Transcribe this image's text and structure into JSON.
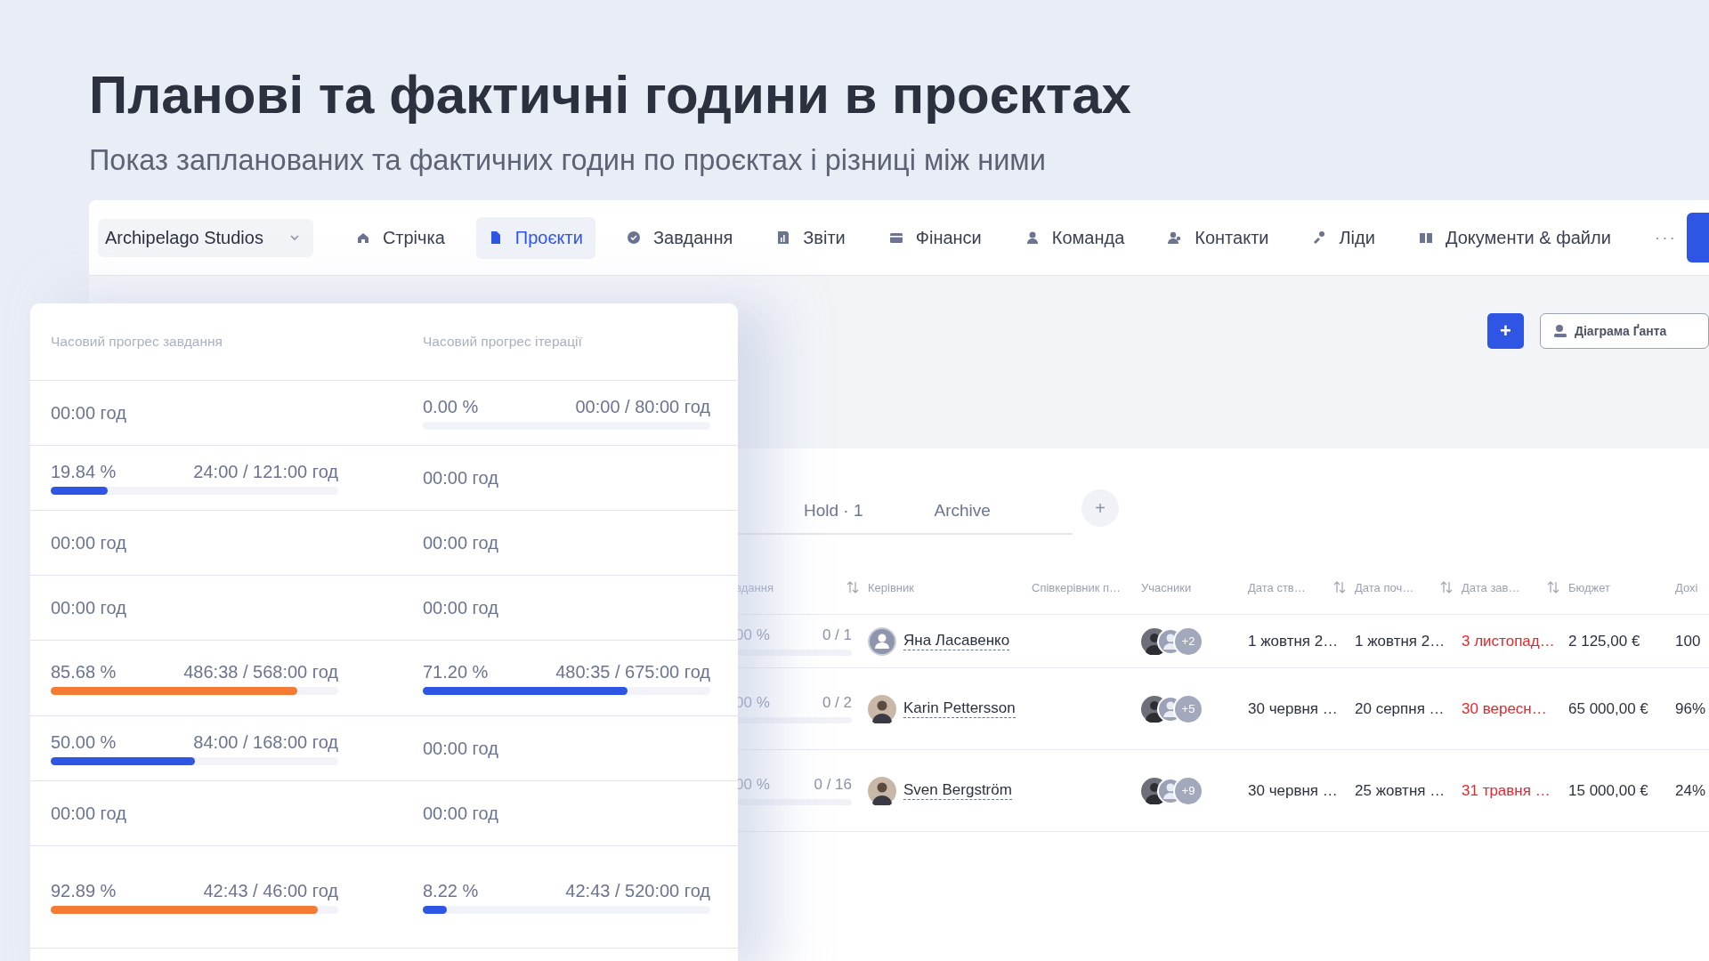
{
  "heading": {
    "title": "Планові та фактичні години в проєктах",
    "subtitle": "Показ запланованих та фактичних годин по проєктах і різниці між ними"
  },
  "workspace": {
    "label": "Archipelago Studios"
  },
  "nav": [
    {
      "label": "Стрічка",
      "selected": false
    },
    {
      "label": "Проєкти",
      "selected": true
    },
    {
      "label": "Завдання",
      "selected": false
    },
    {
      "label": "Звіти",
      "selected": false
    },
    {
      "label": "Фінанси",
      "selected": false
    },
    {
      "label": "Команда",
      "selected": false
    },
    {
      "label": "Контакти",
      "selected": false
    },
    {
      "label": "Ліди",
      "selected": false
    },
    {
      "label": "Документи & файли",
      "selected": false
    }
  ],
  "nav_more": "···",
  "toolbar": {
    "add": "+",
    "gantt": "Діаграма Ґанта"
  },
  "status_tabs": [
    {
      "label": "Hold · 1",
      "selected": false
    },
    {
      "label": "Archive",
      "selected": false
    }
  ],
  "add_tab": "+",
  "table": {
    "columns": [
      {
        "label": "вдання",
        "sortable": true
      },
      {
        "label": "Керівник",
        "sortable": false
      },
      {
        "label": "Співкерівник п…",
        "sortable": false
      },
      {
        "label": "Учасники",
        "sortable": false
      },
      {
        "label": "Дата ств…",
        "sortable": true
      },
      {
        "label": "Дата поч…",
        "sortable": true
      },
      {
        "label": "Дата зав…",
        "sortable": true
      },
      {
        "label": "Бюджет",
        "sortable": false
      },
      {
        "label": "Дохі",
        "sortable": false
      }
    ],
    "rows": [
      {
        "progress": {
          "percent": "00 %",
          "count": "0 / 1"
        },
        "manager": {
          "name": "Яна Ласавенко",
          "kind": "placeholder"
        },
        "members": {
          "more": "+2"
        },
        "created": "1 жовтня 2…",
        "start": "1 жовтня 2…",
        "end": "3 листопад…",
        "budget": "2 125,00 €",
        "income": "100"
      },
      {
        "progress": {
          "percent": "00 %",
          "count": "0 / 2"
        },
        "manager": {
          "name": "Karin Pettersson",
          "kind": "photo"
        },
        "members": {
          "more": "+5"
        },
        "created": "30 червня …",
        "start": "20 серпня …",
        "end": "30 вересн…",
        "budget": "65 000,00 €",
        "income": "96%"
      },
      {
        "progress": {
          "percent": "00 %",
          "count": "0 / 16"
        },
        "manager": {
          "name": "Sven Bergström",
          "kind": "photo"
        },
        "members": {
          "more": "+9"
        },
        "created": "30 червня …",
        "start": "25 жовтня …",
        "end": "31 травня …",
        "budget": "15 000,00 €",
        "income": "24%"
      }
    ]
  },
  "progress_card": {
    "columns": [
      "Часовий прогрес завдання",
      "Часовий прогрес ітерації"
    ],
    "rows": [
      {
        "task": {
          "kind": "plain",
          "hours": "00:00 год"
        },
        "iteration": {
          "kind": "progress",
          "percent": "0.00 %",
          "hours": "00:00 / 80:00 год"
        }
      },
      {
        "task": {
          "kind": "progress",
          "percent": "19.84 %",
          "hours": "24:00 / 121:00 год",
          "level": 0.1984,
          "color": "#2f55e4"
        },
        "iteration": {
          "kind": "plain",
          "hours": "00:00 год"
        }
      },
      {
        "task": {
          "kind": "plain",
          "hours": "00:00 год"
        },
        "iteration": {
          "kind": "plain",
          "hours": "00:00 год"
        }
      },
      {
        "task": {
          "kind": "plain",
          "hours": "00:00 год"
        },
        "iteration": {
          "kind": "plain",
          "hours": "00:00 год"
        }
      },
      {
        "task": {
          "kind": "progress",
          "percent": "85.68 %",
          "hours": "486:38 / 568:00 год",
          "level": 0.8568,
          "color": "#f47b34"
        },
        "iteration": {
          "kind": "progress",
          "percent": "71.20 %",
          "hours": "480:35 / 675:00 год",
          "level": 0.712,
          "color": "#2f55e4"
        }
      },
      {
        "task": {
          "kind": "progress",
          "percent": "50.00 %",
          "hours": "84:00 / 168:00 год",
          "level": 0.5,
          "color": "#2f55e4"
        },
        "iteration": {
          "kind": "plain",
          "hours": "00:00 год"
        }
      },
      {
        "task": {
          "kind": "plain",
          "hours": "00:00 год"
        },
        "iteration": {
          "kind": "plain",
          "hours": "00:00 год"
        }
      },
      {
        "task": {
          "kind": "progress",
          "percent": "92.89 %",
          "hours": "42:43 / 46:00 год",
          "level": 0.9289,
          "color": "#f47b34"
        },
        "iteration": {
          "kind": "progress",
          "percent": "8.22 %",
          "hours": "42:43 / 520:00 год",
          "level": 0.0822,
          "color": "#2f55e4"
        }
      }
    ]
  }
}
